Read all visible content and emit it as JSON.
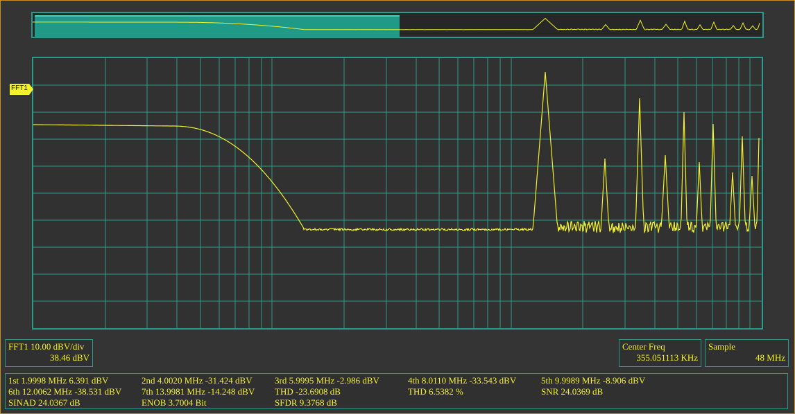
{
  "colors": {
    "trace": "#f3f12c",
    "grid": "#2a9a8c",
    "overview_window": "#1f9a86",
    "frame": "#c9901e",
    "background": "#343434"
  },
  "trace_marker": {
    "label": "FFT1",
    "icon": "arrow-tag-icon"
  },
  "scale_box": {
    "title": "FFT1  10.00 dBV/div",
    "offset": "38.46 dBV"
  },
  "center_freq_box": {
    "title": "Center Freq",
    "value": "355.051113 KHz"
  },
  "sample_box": {
    "title": "Sample",
    "value": "48 MHz"
  },
  "measurements": {
    "rows": [
      [
        "1st 1.9998 MHz  6.391 dBV",
        "2nd 4.0020 MHz  -31.424 dBV",
        "3rd 5.9995 MHz  -2.986 dBV",
        "4th 8.0110 MHz  -33.543 dBV",
        "5th 9.9989 MHz  -8.906 dBV"
      ],
      [
        "6th 12.0062 MHz  -38.531 dBV",
        "7th 13.9981 MHz  -14.248 dBV",
        "THD  -23.6908 dB",
        "THD  6.5382 %",
        "SNR  24.0369 dB"
      ],
      [
        "SINAD  24.0367 dB",
        "ENOB  3.7004 Bit",
        "SFDR  9.3768 dB",
        "",
        ""
      ]
    ]
  }
}
